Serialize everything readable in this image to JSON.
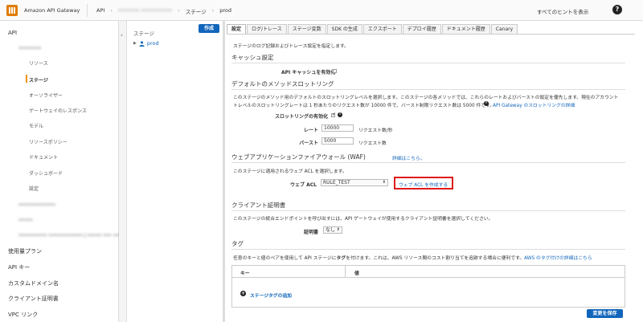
{
  "header": {
    "app_name": "Amazon API Gateway",
    "breadcrumbs": [
      "API",
      "••••••• ••••••••••",
      "ステージ",
      "prod"
    ],
    "hints_label": "すべてのヒントを表示",
    "help_icon": "help-icon"
  },
  "leftnav": {
    "api_label": "API",
    "api_name": "••••••••",
    "api_sub_items": [
      "リソース",
      "ステージ",
      "オーソライザー",
      "ゲートウェイのレスポンス",
      "モデル",
      "リソースポリシー",
      "ドキュメント",
      "ダッシュボード",
      "設定"
    ],
    "other_apis": [
      "•••••••••••••",
      "•••••",
      "•••••••••• •••••••••••• / ••••• ••• ••• •••"
    ],
    "bottom_items": [
      "使用量プラン",
      "API キー",
      "カスタムドメイン名",
      "クライアント証明書",
      "VPC リンク"
    ],
    "active_index": 1
  },
  "stages": {
    "title": "ステージ",
    "create_label": "作成",
    "items": [
      "prod"
    ]
  },
  "tabs": [
    "設定",
    "ログ/トレース",
    "ステージ変数",
    "SDK の生成",
    "エクスポート",
    "デプロイ履歴",
    "ドキュメント履歴",
    "Canary"
  ],
  "settings": {
    "intro": "ステージのログ記録およびトレース設定を指定します。",
    "cache": {
      "heading": "キャッシュ設定",
      "enable_label": "API キャッシュを有効化"
    },
    "throttling": {
      "heading": "デフォルトのメソッドスロットリング",
      "desc_line1": "このステージのメソッド用のデフォルトのスロットリングレベルを選択します。このステージの各メソッドでは、これらのレートおよびバーストの設定を優先します。現在のアカウント",
      "desc_line2": "トレベルのスロットリングレートは 1 秒あたりのリクエスト数が 10000 件で、バースト制限リクエスト数は 5000 件です。",
      "desc_link": "API Gateway のスロットリングの詳細",
      "enable_label": "スロットリングの有効化",
      "rate_label": "レート",
      "rate_value": "10000",
      "rate_unit": "リクエスト数/秒",
      "burst_label": "バースト",
      "burst_value": "5000",
      "burst_unit": "リクエスト数"
    },
    "waf": {
      "heading": "ウェブアプリケーションファイアウォール (WAF)",
      "heading_link": "詳細はこちら。",
      "desc": "このステージに適用されるウェブ ACL を選択します。",
      "acl_label": "ウェブ ACL",
      "acl_value": "RULE_TEST",
      "create_acl_link": "ウェブ ACL を作成する"
    },
    "client_cert": {
      "heading": "クライアント証明書",
      "desc": "このステージの統合エンドポイントを呼び出すには、API ゲートウェイが使用するクライアント証明書を選択してください。",
      "cert_label": "証明書",
      "cert_value": "なし"
    },
    "tags": {
      "heading": "タグ",
      "desc_before": "任意のキーと値のペアを使用して API ステージに",
      "desc_bold": "タグ",
      "desc_after": "を付けます。これは、AWS リソース間のコスト割り当てを追跡する場合に便利です。",
      "desc_link": "AWS のタグ付けの詳細はこちら",
      "col_key": "キー",
      "col_value": "値",
      "add_label": "ステージタグの追加"
    },
    "save_label": "変更を保存"
  },
  "colors": {
    "accent": "#1166bb",
    "active_marker": "#f29100",
    "highlight_box": "#e01a1a"
  }
}
